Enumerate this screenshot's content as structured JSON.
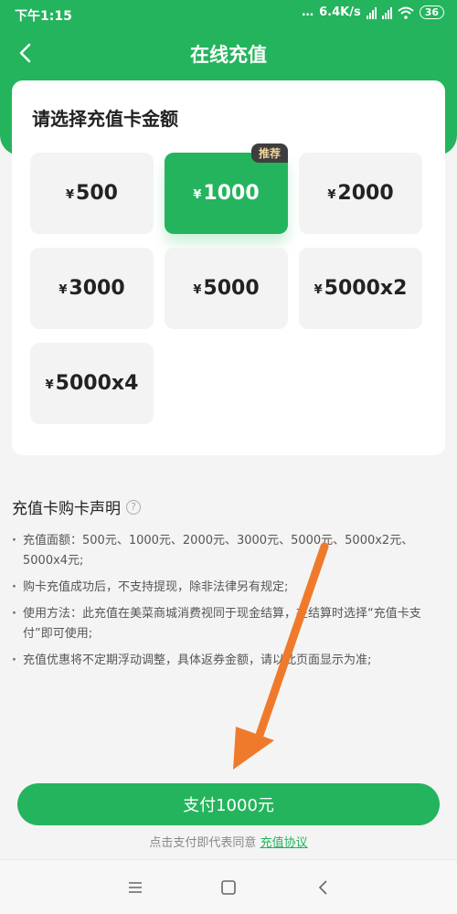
{
  "status_bar": {
    "time": "下午1:15",
    "speed": "6.4K/s",
    "battery": "36"
  },
  "header": {
    "title": "在线充值",
    "back_icon": "chevron-left-icon"
  },
  "card": {
    "title": "请选择充值卡金额",
    "currency": "¥",
    "options": [
      {
        "label": "500"
      },
      {
        "label": "1000",
        "selected": true,
        "badge": "推荐"
      },
      {
        "label": "2000"
      },
      {
        "label": "3000"
      },
      {
        "label": "5000"
      },
      {
        "label": "5000x2"
      },
      {
        "label": "5000x4"
      }
    ]
  },
  "declaration": {
    "title": "充值卡购卡声明",
    "help_icon": "question-circle-icon",
    "items": [
      "充值面额：500元、1000元、2000元、3000元、5000元、5000x2元、5000x4元;",
      "购卡充值成功后，不支持提现，除非法律另有规定;",
      "使用方法：此充值在美菜商城消费视同于现金结算，在结算时选择“充值卡支付”即可使用;",
      "充值优惠将不定期浮动调整，具体返券金额，请以此页面显示为准;"
    ]
  },
  "footer": {
    "pay_label": "支付1000元",
    "agree_text": "点击支付即代表同意",
    "agree_link": "充值协议"
  },
  "colors": {
    "primary": "#24b45d",
    "annotation_arrow": "#f07a2c"
  }
}
